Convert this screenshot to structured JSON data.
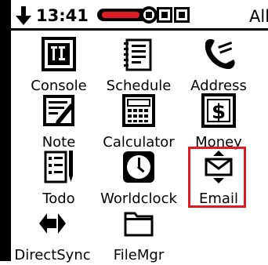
{
  "status": {
    "time": "13:41",
    "filter": "All",
    "download_icon": "down-arrow-icon",
    "battery_icon": "battery-icon"
  },
  "highlight_color": "#e01b24",
  "apps": [
    {
      "label": "Console",
      "icon": "console-icon"
    },
    {
      "label": "Schedule",
      "icon": "schedule-icon"
    },
    {
      "label": "Address",
      "icon": "address-icon"
    },
    {
      "label": "Note",
      "icon": "note-icon"
    },
    {
      "label": "Calculator",
      "icon": "calculator-icon"
    },
    {
      "label": "Money",
      "icon": "money-icon"
    },
    {
      "label": "Todo",
      "icon": "todo-icon"
    },
    {
      "label": "Worldclock",
      "icon": "worldclock-icon"
    },
    {
      "label": "Email",
      "icon": "email-icon"
    },
    {
      "label": "DirectSync",
      "icon": "directsync-icon"
    },
    {
      "label": "FileMgr",
      "icon": "filemgr-icon"
    }
  ]
}
